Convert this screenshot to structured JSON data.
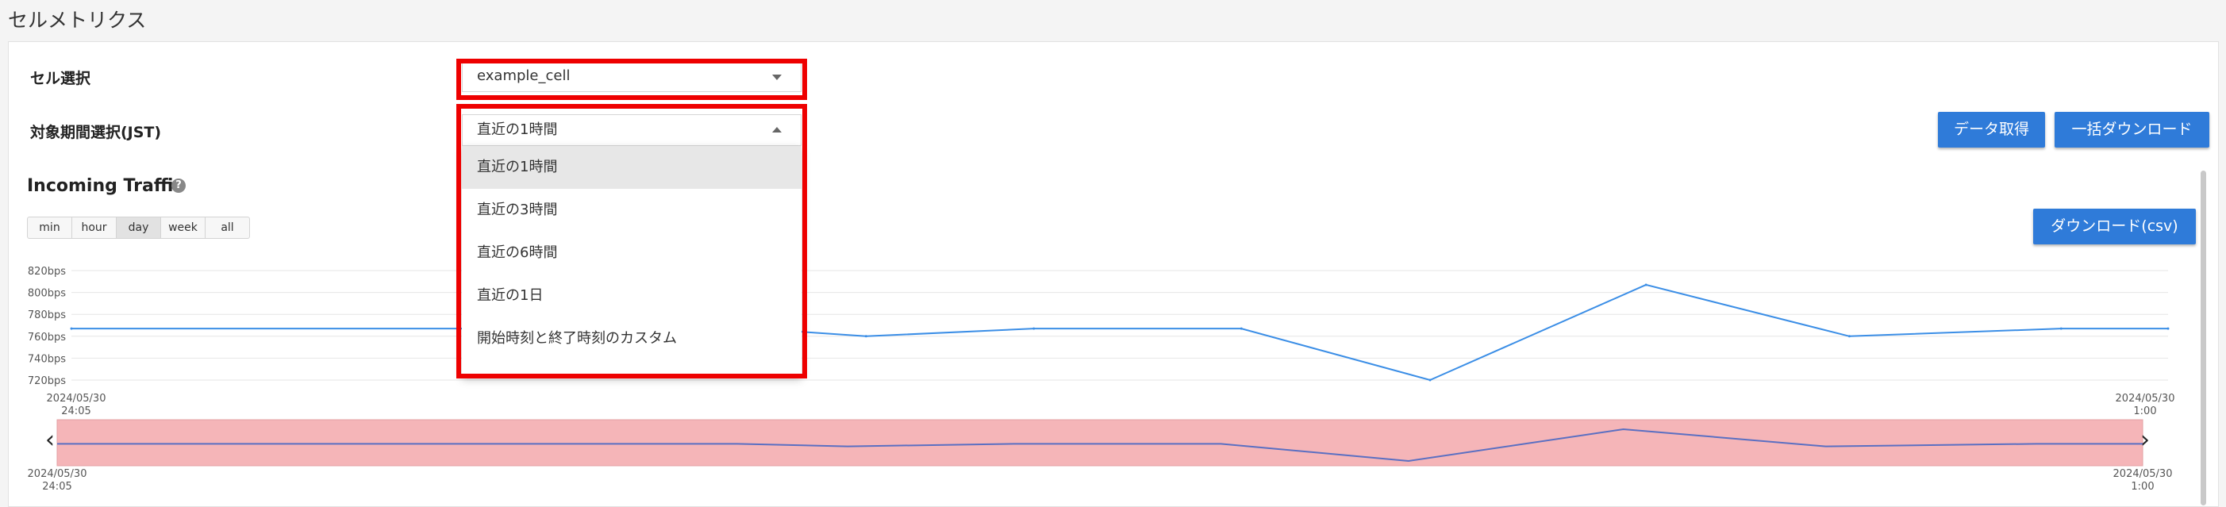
{
  "page": {
    "title": "セルメトリクス"
  },
  "form": {
    "cell_label": "セル選択",
    "cell_value": "example_cell",
    "period_label": "対象期間選択(JST)",
    "period_value": "直近の1時間",
    "period_options": [
      "直近の1時間",
      "直近の3時間",
      "直近の6時間",
      "直近の1日",
      "開始時刻と終了時刻のカスタム"
    ]
  },
  "toolbar": {
    "fetch_label": "データ取得",
    "bulk_download_label": "一括ダウンロード",
    "csv_download_label": "ダウンロード(csv)"
  },
  "chart_section": {
    "title": "Incoming Traffic",
    "help_icon": "?",
    "range_buttons": [
      "min",
      "hour",
      "day",
      "week",
      "all"
    ],
    "active_range": "day",
    "nav_left_icon": "‹",
    "nav_right_icon": "›"
  },
  "colors": {
    "accent": "#2f7bd9",
    "line": "#3b8ee6",
    "highlight": "#ee0000",
    "navigator_fill": "#f5b5b8"
  },
  "icons": {
    "select_caret": "chevron-down-icon",
    "open_caret": "chevron-up-icon",
    "help": "help-circle-icon",
    "nav_left": "chevron-left-icon",
    "nav_right": "chevron-right-icon"
  },
  "chart_data": {
    "type": "line",
    "title": "Incoming Traffic",
    "y_tick_labels": [
      "820bps",
      "800bps",
      "780bps",
      "760bps",
      "740bps",
      "720bps"
    ],
    "y_ticks": [
      820,
      800,
      780,
      760,
      740,
      720
    ],
    "ylim": [
      720,
      820
    ],
    "x_tick_labels": [
      {
        "date": "2024/05/30",
        "time": "24:05"
      },
      {
        "date": "2024/05/30",
        "time": "1:00"
      }
    ],
    "x": [
      0,
      0.199,
      0.326,
      0.379,
      0.459,
      0.558,
      0.648,
      0.751,
      0.848,
      0.949,
      1.0
    ],
    "series": [
      {
        "values": [
          767,
          767,
          767,
          760,
          767,
          767,
          720,
          807,
          760,
          767,
          767
        ]
      }
    ],
    "navigator": {
      "x_tick_labels": [
        {
          "date": "2024/05/30",
          "time": "24:05"
        },
        {
          "date": "2024/05/30",
          "time": "1:00"
        }
      ]
    },
    "grid": true,
    "legend": "none"
  }
}
